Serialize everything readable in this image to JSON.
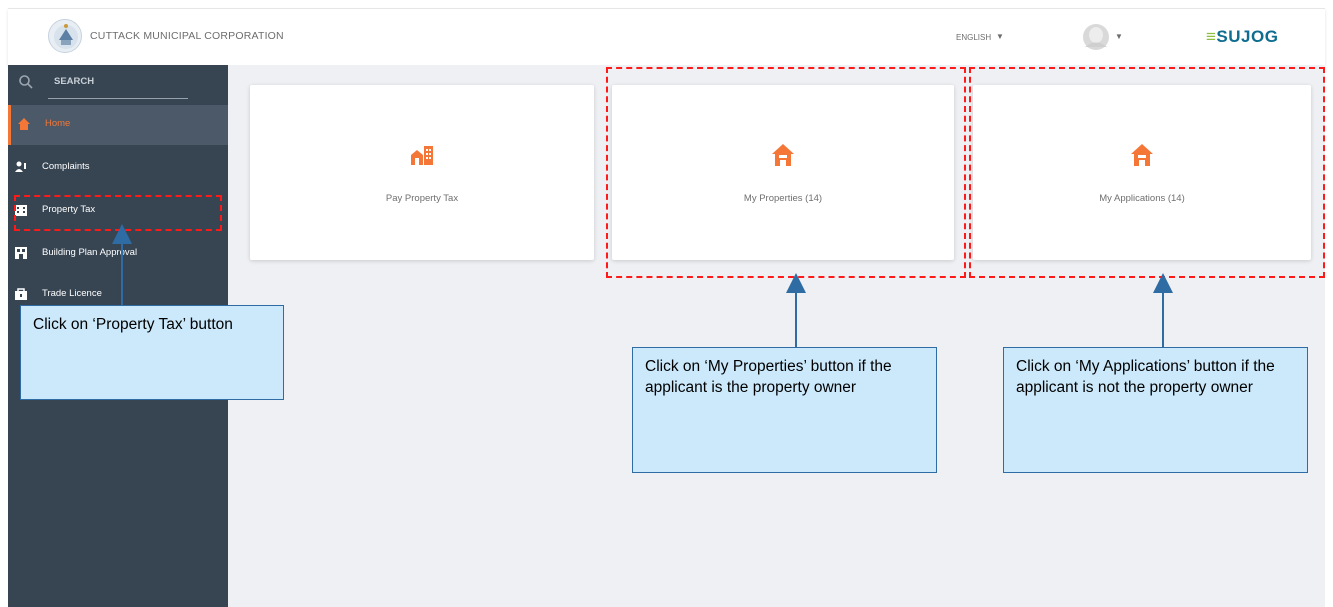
{
  "header": {
    "org_name": "CUTTACK MUNICIPAL CORPORATION",
    "language": "ENGLISH",
    "brand": "SUJOG",
    "logo_icon": "municipal-emblem-icon",
    "avatar_icon": "user-avatar-icon"
  },
  "sidebar": {
    "search_label": "SEARCH",
    "items": [
      {
        "label": "Home",
        "icon": "home-icon",
        "active": true
      },
      {
        "label": "Complaints",
        "icon": "complaints-icon",
        "active": false
      },
      {
        "label": "Property Tax",
        "icon": "property-tax-icon",
        "active": false
      },
      {
        "label": "Building Plan Approval",
        "icon": "building-plan-icon",
        "active": false
      },
      {
        "label": "Trade Licence",
        "icon": "trade-licence-icon",
        "active": false
      }
    ]
  },
  "cards": [
    {
      "label": "Pay Property Tax",
      "icon": "buildings-icon"
    },
    {
      "label": "My Properties (14)",
      "icon": "house-icon"
    },
    {
      "label": "My Applications (14)",
      "icon": "house-icon"
    }
  ],
  "annotations": {
    "property_tax": "Click on ‘Property Tax’ button",
    "my_properties": "Click on ‘My Properties’ button if the applicant is the property owner",
    "my_applications": "Click on ‘My Applications’ button if the applicant is not the property owner"
  },
  "colors": {
    "sidebar_bg": "#374553",
    "accent": "#f47738",
    "annotation_box": "#cce9fb",
    "annotation_border": "#2f6ca3",
    "highlight_dash": "#ff1a1a",
    "brand": "#0f6d90"
  }
}
